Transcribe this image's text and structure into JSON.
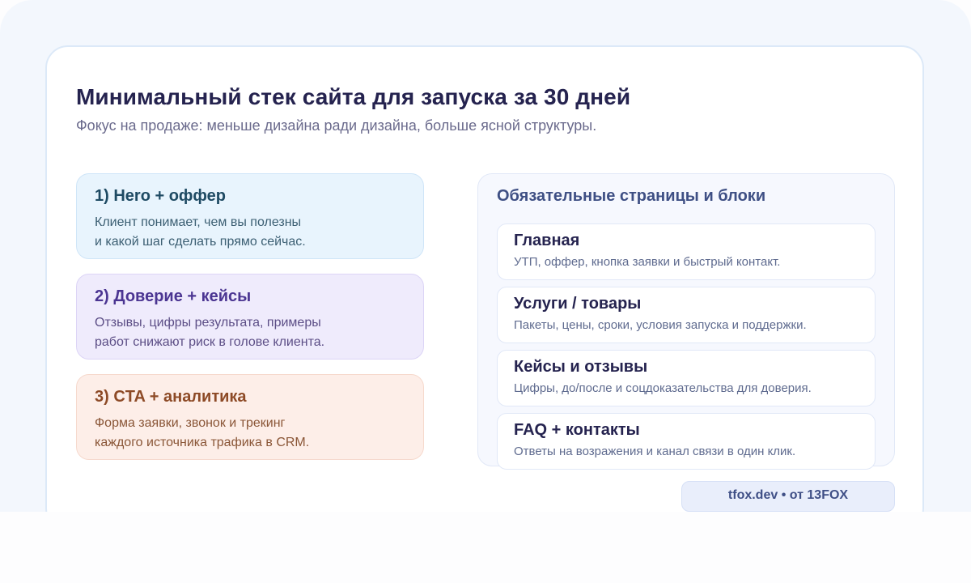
{
  "header": {
    "title": "Минимальный стек сайта для запуска за 30 дней",
    "subtitle": "Фокус на продаже: меньше дизайна ради дизайна, больше ясной структуры."
  },
  "steps": [
    {
      "title": "1) Hero + оффер",
      "text": "Клиент понимает, чем вы полезны\nи какой шаг сделать прямо сейчас."
    },
    {
      "title": "2) Доверие + кейсы",
      "text": "Отзывы, цифры результата, примеры\nработ снижают риск в голове клиента."
    },
    {
      "title": "3) CTA + аналитика",
      "text": "Форма заявки, звонок и трекинг\nкаждого источника трафика в CRM."
    }
  ],
  "pages": {
    "title": "Обязательные страницы и блоки",
    "items": [
      {
        "title": "Главная",
        "desc": "УТП, оффер, кнопка заявки и быстрый контакт."
      },
      {
        "title": "Услуги / товары",
        "desc": "Пакеты, цены, сроки, условия запуска и поддержки."
      },
      {
        "title": "Кейсы и отзывы",
        "desc": "Цифры, до/после и соцдоказательства для доверия."
      },
      {
        "title": "FAQ + контакты",
        "desc": "Ответы на возражения и канал связи в один клик."
      }
    ]
  },
  "footer": {
    "badge": "tfox.dev • от 13FOX"
  },
  "colors": {
    "title": "#25234f",
    "step1_bg": "#e8f4fd",
    "step2_bg": "#efebfc",
    "step3_bg": "#fdeee8",
    "panel_bg": "#f6f8fe"
  }
}
